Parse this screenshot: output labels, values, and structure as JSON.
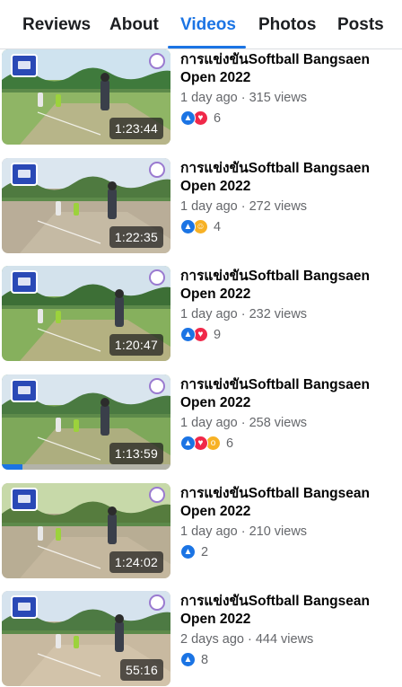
{
  "tabs": [
    {
      "label": "Reviews",
      "active": false
    },
    {
      "label": "About",
      "active": false
    },
    {
      "label": "Videos",
      "active": true
    },
    {
      "label": "Photos",
      "active": false
    },
    {
      "label": "Posts",
      "active": false
    }
  ],
  "colors": {
    "accent": "#1b74e4",
    "text": "#050505",
    "muted": "#65676b"
  },
  "videos": [
    {
      "title": "การแข่งขันSoftball Bangsaen Open 2022",
      "meta": "1 day ago · 315 views",
      "duration": "1:23:44",
      "reactions": [
        "like-icon",
        "love-icon"
      ],
      "reaction_count": "6",
      "progress": 0
    },
    {
      "title": "การแข่งขันSoftball Bangsaen Open 2022",
      "meta": "1 day ago · 272 views",
      "duration": "1:22:35",
      "reactions": [
        "like-icon",
        "haha-icon"
      ],
      "reaction_count": "4",
      "progress": 0
    },
    {
      "title": "การแข่งขันSoftball Bangsaen Open 2022",
      "meta": "1 day ago · 232 views",
      "duration": "1:20:47",
      "reactions": [
        "like-icon",
        "love-icon"
      ],
      "reaction_count": "9",
      "progress": 0
    },
    {
      "title": "การแข่งขันSoftball Bangsaen Open 2022",
      "meta": "1 day ago · 258 views",
      "duration": "1:13:59",
      "reactions": [
        "like-icon",
        "love-icon",
        "wow-icon"
      ],
      "reaction_count": "6",
      "progress": 0.12
    },
    {
      "title": "การแข่งขันSoftball Bangsean Open 2022",
      "meta": "1 day ago · 210 views",
      "duration": "1:24:02",
      "reactions": [
        "like-icon"
      ],
      "reaction_count": "2",
      "progress": 0
    },
    {
      "title": "การแข่งขันSoftball Bangsean Open 2022",
      "meta": "2 days ago · 444 views",
      "duration": "55:16",
      "reactions": [
        "like-icon"
      ],
      "reaction_count": "8",
      "progress": 0
    }
  ]
}
